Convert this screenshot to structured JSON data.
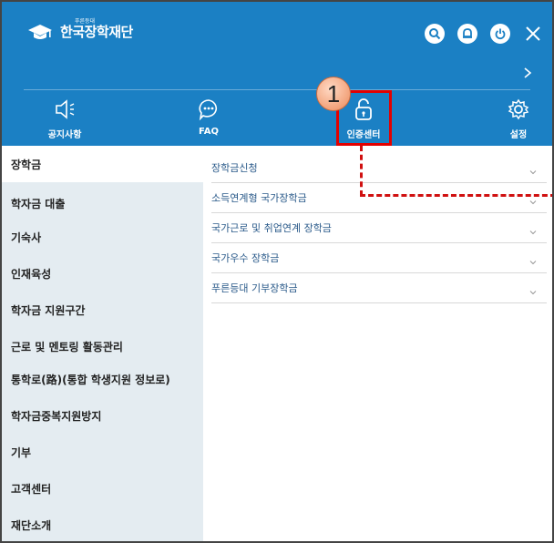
{
  "brand": {
    "name": "한국장학재단",
    "tagline": "푸른등대"
  },
  "header_icons": [
    "search-icon",
    "bell-icon",
    "power-icon",
    "close-icon"
  ],
  "nav": [
    {
      "label": "공지사항",
      "icon": "megaphone-icon"
    },
    {
      "label": "FAQ",
      "icon": "chat-bubble-icon"
    },
    {
      "label": "인증센터",
      "icon": "lock-icon"
    },
    {
      "label": "설정",
      "icon": "gear-icon"
    }
  ],
  "annotation": {
    "step": "1"
  },
  "sidebar": {
    "items": [
      "장학금",
      "학자금 대출",
      "기숙사",
      "인재육성",
      "학자금 지원구간",
      "근로 및 멘토링 활동관리",
      "통학로(路)(통합 학생지원 정보로)",
      "학자금중복지원방지",
      "기부",
      "고객센터",
      "재단소개"
    ],
    "active_index": 0
  },
  "submenu": {
    "items": [
      "장학금신청",
      "소득연계형 국가장학금",
      "국가근로 및 취업연계 장학금",
      "국가우수 장학금",
      "푸른등대 기부장학금"
    ]
  },
  "colors": {
    "header": "#1b80c4",
    "sidebar": "#e4ecf1",
    "highlight": "#e30000",
    "menu_text": "#2a5a8a"
  }
}
